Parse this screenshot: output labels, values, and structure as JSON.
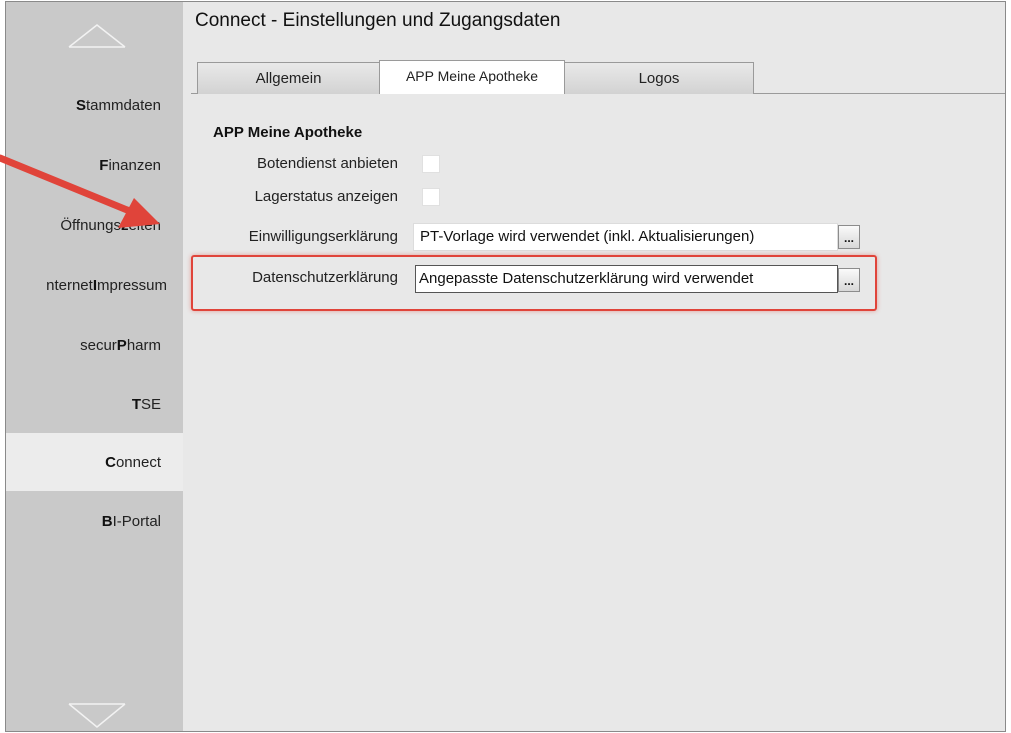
{
  "page_title": "Connect - Einstellungen und Zugangsdaten",
  "sidebar": {
    "items": [
      {
        "bold": "S",
        "rest": "tammdaten"
      },
      {
        "bold": "F",
        "rest": "inanzen"
      },
      {
        "pre": "Öffnungs",
        "bold": "z",
        "rest": "eiten"
      },
      {
        "pre": "nternet ",
        "bold": "I",
        "rest": "mpressum"
      },
      {
        "pre": "secur",
        "bold": "P",
        "rest": "harm"
      },
      {
        "bold": "T",
        "rest": "SE"
      },
      {
        "bold": "C",
        "rest": "onnect"
      },
      {
        "bold": "B",
        "rest": "I-Portal"
      }
    ],
    "active_item": "Connect"
  },
  "tabs": [
    "Allgemein",
    "APP Meine Apotheke",
    "Logos"
  ],
  "active_tab": "APP Meine Apotheke",
  "section": {
    "title": "APP Meine Apotheke",
    "botendienst_label": "Botendienst anbieten",
    "lagerstatus_label": "Lagerstatus anzeigen",
    "einwilligung_label": "Einwilligungserklärung",
    "einwilligung_value": "PT-Vorlage wird verwendet (inkl. Aktualisierungen)",
    "datenschutz_label": "Datenschutzerklärung",
    "datenschutz_value": "Angepasste Datenschutzerklärung wird verwendet",
    "dots_label": "..."
  },
  "colors": {
    "highlight": "#e0443a",
    "sidebar_bg": "#c9c9c9",
    "content_bg": "#e8e8e8"
  }
}
